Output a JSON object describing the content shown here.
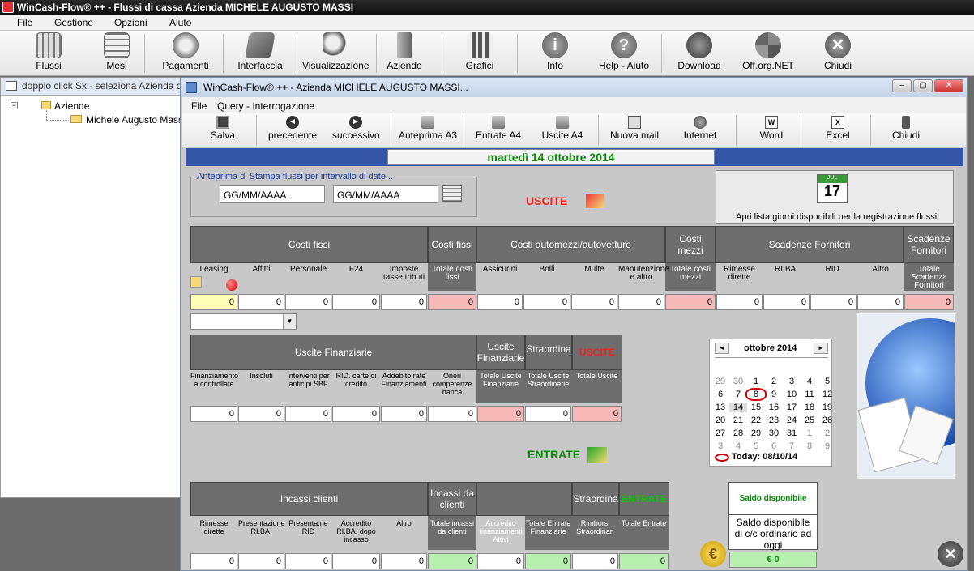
{
  "app_title": "WinCash-Flow® ++ - Flussi di cassa Azienda MICHELE AUGUSTO MASSI",
  "menu": [
    "File",
    "Gestione",
    "Opzioni",
    "Aiuto"
  ],
  "toolbar": [
    {
      "label": "Flussi",
      "icon": "grid-icon"
    },
    {
      "label": "Mesi",
      "icon": "calendar-grid-icon"
    },
    {
      "label": "Pagamenti",
      "icon": "coins-icon"
    },
    {
      "label": "Interfaccia",
      "icon": "book-icon"
    },
    {
      "label": "Visualizzazione",
      "icon": "magnifier-icon"
    },
    {
      "label": "Aziende",
      "icon": "building-icon"
    },
    {
      "label": "Grafici",
      "icon": "chart-icon"
    },
    {
      "label": "Info",
      "icon": "info-icon"
    },
    {
      "label": "Help - Aiuto",
      "icon": "help-icon"
    },
    {
      "label": "Download",
      "icon": "download-icon"
    },
    {
      "label": "Off.org.NET",
      "icon": "globe-icon"
    },
    {
      "label": "Chiudi",
      "icon": "close-icon"
    }
  ],
  "left_panel": {
    "title": "doppio click Sx - seleziona Azienda d",
    "root": "Aziende",
    "child": "Michele Augusto Massi"
  },
  "window": {
    "title": "WinCash-Flow® ++ - Azienda MICHELE AUGUSTO MASSI...",
    "controls": [
      "–",
      "▢",
      "✕"
    ],
    "menu": [
      "File",
      "Query - Interrogazione"
    ],
    "toolbar": [
      {
        "label": "Salva",
        "icon": "save-icon"
      },
      {
        "label": "precedente",
        "icon": "prev-icon"
      },
      {
        "label": "successivo",
        "icon": "next-icon"
      },
      {
        "label": "Anteprima A3",
        "icon": "printer-icon"
      },
      {
        "label": "Entrate A4",
        "icon": "printer-icon"
      },
      {
        "label": "Uscite A4",
        "icon": "printer-icon"
      },
      {
        "label": "Nuova mail",
        "icon": "mail-icon"
      },
      {
        "label": "Internet",
        "icon": "internet-icon"
      },
      {
        "label": "Word",
        "icon": "word-icon"
      },
      {
        "label": "Excel",
        "icon": "excel-icon"
      },
      {
        "label": "Chiudi",
        "icon": "exit-icon"
      }
    ],
    "date": "martedì 14 ottobre 2014",
    "preview_group": "Anteprima di Stampa flussi per intervallo di date...",
    "date_from": "GG/MM/AAAA",
    "date_to": "GG/MM/AAAA",
    "uscite_label": "USCITE",
    "entrate_label": "ENTRATE",
    "open_list_btn": "Apri lista giorni disponibili per la registrazione flussi",
    "cal_icon_month": "JUL",
    "cal_icon_day": "17",
    "costi": {
      "headers": [
        "Costi fissi",
        "Costi fissi",
        "Costi automezzi/autovetture",
        "Costi mezzi",
        "Scadenze Fornitori",
        "Scadenze Fornitori"
      ],
      "subs": [
        "Leasing",
        "Affitti",
        "Personale",
        "F24",
        "Imposte tasse tributi",
        "Totale costi fissi",
        "Assicur.ni",
        "Bolli",
        "Multe",
        "Manutenzione e altro",
        "Totale costi mezzi",
        "Rimesse dirette",
        "RI.BA.",
        "RID.",
        "Altro",
        "Totale Scadenza Fornitori"
      ],
      "values": [
        "0",
        "0",
        "0",
        "0",
        "0",
        "0",
        "0",
        "0",
        "0",
        "0",
        "0",
        "0",
        "0",
        "0",
        "0",
        "0"
      ]
    },
    "fin": {
      "headers": [
        "Uscite Finanziarie",
        "Uscite Finanziarie",
        "Straordina",
        "USCITE"
      ],
      "subs": [
        "Finanziamento a controllate",
        "Insoluti",
        "Interventi per anticipi SBF",
        "RID. carte di credito",
        "Addebito rate Finanziamenti",
        "Oneri competenze banca",
        "Totale Uscite Finanziarie",
        "Totale Uscite Straordinarie",
        "Totale Uscite"
      ],
      "values": [
        "0",
        "0",
        "0",
        "0",
        "0",
        "0",
        "0",
        "0",
        "0"
      ]
    },
    "incassi": {
      "headers": [
        "Incassi clienti",
        "Incassi da clienti",
        "",
        "Straordina",
        "ENTRATE"
      ],
      "subs": [
        "Rimesse dirette",
        "Presentazione RI.BA.",
        "Presenta.ne RID",
        "Accredito RI.BA. dopo incasso",
        "Altro",
        "Totale incassi da clienti",
        "Accredito finanziamenti Attivi",
        "Totale Entrate Finanziarie",
        "Rimborsi Straordinari",
        "Totale Entrate"
      ],
      "values": [
        "0",
        "0",
        "0",
        "0",
        "0",
        "0",
        "0",
        "0",
        "0",
        "0"
      ]
    },
    "calendar": {
      "month": "ottobre 2014",
      "weeks": [
        [
          "29",
          "30",
          "1",
          "2",
          "3",
          "4",
          "5"
        ],
        [
          "6",
          "7",
          "8",
          "9",
          "10",
          "11",
          "12"
        ],
        [
          "13",
          "14",
          "15",
          "16",
          "17",
          "18",
          "19"
        ],
        [
          "20",
          "21",
          "22",
          "23",
          "24",
          "25",
          "26"
        ],
        [
          "27",
          "28",
          "29",
          "30",
          "31",
          "1",
          "2"
        ],
        [
          "3",
          "4",
          "5",
          "6",
          "7",
          "8",
          "9"
        ]
      ],
      "today": "Today: 08/10/14"
    },
    "saldo": {
      "title": "Saldo disponibile",
      "desc": "Saldo disponibile di c/c ordinario ad oggi",
      "value": "€ 0"
    }
  }
}
